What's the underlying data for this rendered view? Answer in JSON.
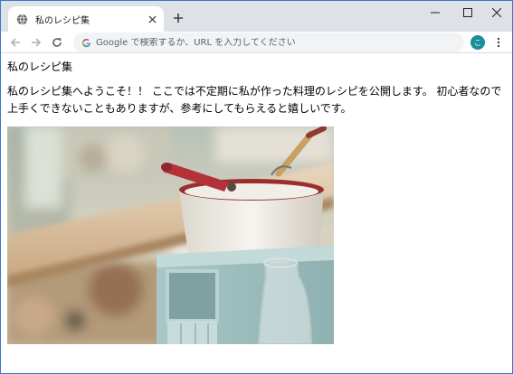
{
  "browser": {
    "tab_title": "私のレシピ集",
    "omnibox_placeholder": "Google で検索するか、URL を入力してください",
    "avatar_letter": "こ",
    "avatar_color": "#1a8f9b",
    "icons": {
      "favicon": "globe-icon",
      "tab_close": "close-icon",
      "new_tab": "plus-icon",
      "minimize": "minimize-icon",
      "maximize": "maximize-icon",
      "close": "close-icon",
      "back": "back-arrow-icon",
      "forward": "forward-arrow-icon",
      "reload": "reload-icon",
      "search": "google-g-icon",
      "menu": "kebab-menu-icon"
    }
  },
  "page": {
    "title": "私のレシピ集",
    "intro": "私のレシピ集へようこそ！！ ここでは不定期に私が作った料理のレシピを公開します。 初心者なので上手くできないこともありますが、参考にしてもらえると嬉しいです。",
    "image_subject": "kitchen photo with white enamel pot on blue shelf"
  }
}
